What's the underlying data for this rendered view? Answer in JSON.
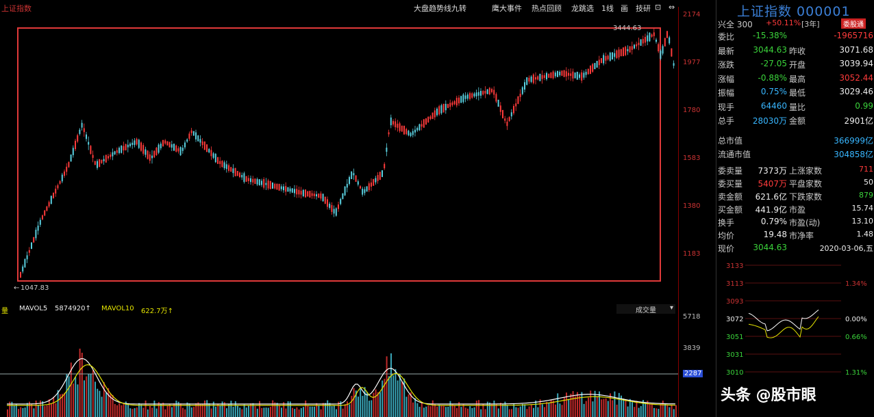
{
  "toolbar": {
    "left_label": "上证指数",
    "items": [
      "大盘趋势线九转",
      "鹰大事件",
      "热点回顾",
      "龙跳选",
      "1线",
      "画",
      "技研"
    ]
  },
  "colors": {
    "up": "#ff3b3b",
    "down": "#3bd43b",
    "box": "#e23a3a",
    "ma5": "#ffffff",
    "ma10": "#e6e600"
  },
  "main_chart": {
    "high_label": "3444.63",
    "low_label": "1047.83",
    "price_axis": [
      "2174",
      "1977",
      "1780",
      "1583",
      "1380",
      "1183"
    ]
  },
  "volume": {
    "label": "量",
    "ma5_label": "MAVOL5",
    "ma5_value": "5874920↑",
    "ma10_label": "MAVOL10",
    "ma10_value": "622.7万↑",
    "dropdown": "成交量",
    "axis": [
      "5718",
      "3839",
      "2287"
    ]
  },
  "quote": {
    "title": "上证指数 000001",
    "sub_left": "兴全 300",
    "sub_pct": "+50.11%",
    "sub_period": "[3年]",
    "sub_btn": "委股通",
    "rows": [
      {
        "l": "委比",
        "v": "-15.38%",
        "l2": "",
        "v2": "-1965716"
      },
      {
        "l": "最新",
        "v": "3044.63",
        "l2": "昨收",
        "v2": "3071.68"
      },
      {
        "l": "涨跌",
        "v": "-27.05",
        "l2": "开盘",
        "v2": "3039.94"
      },
      {
        "l": "涨幅",
        "v": "-0.88%",
        "l2": "最高",
        "v2": "3052.44"
      },
      {
        "l": "振幅",
        "v": "0.75%",
        "l2": "最低",
        "v2": "3029.46"
      },
      {
        "l": "现手",
        "v": "64460",
        "l2": "量比",
        "v2": "0.99"
      },
      {
        "l": "总手",
        "v": "28030万",
        "l2": "金额",
        "v2": "2901亿"
      }
    ],
    "rows2": [
      {
        "l": "总市值",
        "v": "366999亿"
      },
      {
        "l": "流通市值",
        "v": "304858亿"
      }
    ],
    "rows3": [
      {
        "l": "委卖量",
        "v": "7373万",
        "l2": "上涨家数",
        "v2": "711"
      },
      {
        "l": "委买量",
        "v": "5407万",
        "l2": "平盘家数",
        "v2": "50"
      },
      {
        "l": "卖金额",
        "v": "621.6亿",
        "l2": "下跌家数",
        "v2": "879"
      },
      {
        "l": "买金额",
        "v": "441.9亿",
        "l2": "市盈",
        "v2": "15.74"
      },
      {
        "l": "换手",
        "v": "0.79%",
        "l2": "市盈(动)",
        "v2": "13.10"
      },
      {
        "l": "均价",
        "v": "19.48",
        "l2": "市净率",
        "v2": "1.48"
      },
      {
        "l": "现价",
        "v": "3044.63",
        "l2": "",
        "v2": "2020-03-06,五"
      }
    ],
    "mini_axis_left": [
      "3133",
      "3113",
      "3093",
      "3072",
      "3051",
      "3031",
      "3010"
    ],
    "mini_axis_right": [
      "",
      "1.34%",
      "",
      "0.00%",
      "0.66%",
      "",
      "1.31%"
    ]
  },
  "watermark": "头条 @股市眼"
}
